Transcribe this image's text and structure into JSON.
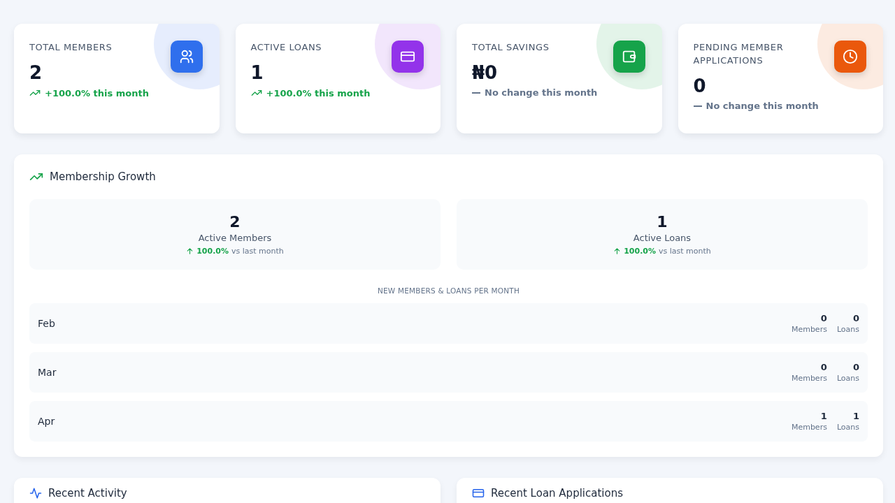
{
  "stats": [
    {
      "kind": "people",
      "label": "TOTAL MEMBERS",
      "value": "2",
      "change": {
        "kind": "up",
        "text": "+100.0% this month"
      },
      "color": "#2f6fed"
    },
    {
      "kind": "card",
      "label": "ACTIVE LOANS",
      "value": "1",
      "change": {
        "kind": "up",
        "text": "+100.0% this month"
      },
      "color": "#9333ea"
    },
    {
      "kind": "wallet",
      "label": "TOTAL SAVINGS",
      "value": "₦0",
      "change": {
        "kind": "flat",
        "text": "No change this month"
      },
      "color": "#16a34a"
    },
    {
      "kind": "clock",
      "label": "PENDING MEMBER APPLICATIONS",
      "value": "0",
      "change": {
        "kind": "flat",
        "text": "No change this month"
      },
      "color": "#ea580c"
    }
  ],
  "growth": {
    "title": "Membership Growth",
    "summary": [
      {
        "value": "2",
        "label": "Active Members",
        "percent": "100.0%",
        "note": "vs last month"
      },
      {
        "value": "1",
        "label": "Active Loans",
        "percent": "100.0%",
        "note": "vs last month"
      }
    ],
    "heading": "NEW MEMBERS & LOANS PER MONTH",
    "months": [
      {
        "month": "Feb",
        "members": "0",
        "members_label": "Members",
        "loans": "0",
        "loans_label": "Loans"
      },
      {
        "month": "Mar",
        "members": "0",
        "members_label": "Members",
        "loans": "0",
        "loans_label": "Loans"
      },
      {
        "month": "Apr",
        "members": "1",
        "members_label": "Members",
        "loans": "1",
        "loans_label": "Loans"
      }
    ]
  },
  "bottom_panels": [
    {
      "kind": "activity",
      "title": "Recent Activity"
    },
    {
      "kind": "card",
      "title": "Recent Loan Applications"
    }
  ]
}
